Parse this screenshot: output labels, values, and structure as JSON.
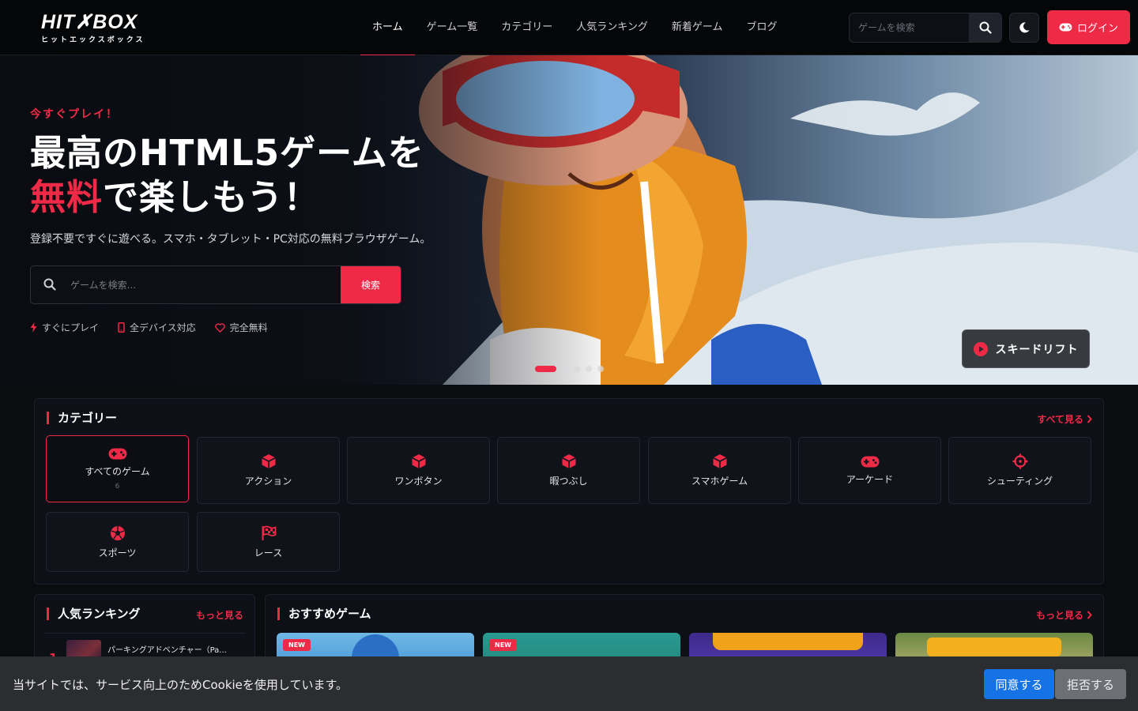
{
  "brand": {
    "logo_text": "HIT✗BOX",
    "logo_sub": "ヒットエックスボックス",
    "accent_color": "#ee2a47"
  },
  "nav": {
    "items": [
      {
        "label": "ホーム",
        "active": true
      },
      {
        "label": "ゲーム一覧"
      },
      {
        "label": "カテゴリー"
      },
      {
        "label": "人気ランキング"
      },
      {
        "label": "新着ゲーム"
      },
      {
        "label": "ブログ"
      }
    ],
    "search_placeholder": "ゲームを検索",
    "login_label": "ログイン"
  },
  "hero": {
    "kicker": "今すぐプレイ！",
    "title_line1": "最高のHTML5ゲームを",
    "title_accent": "無料",
    "title_line2_rest": "で楽しもう！",
    "description": "登録不要ですぐに遊べる。スマホ・タブレット・PC対応の無料ブラウザゲーム。",
    "search_placeholder": "ゲームを検索...",
    "search_button": "検索",
    "features": [
      "すぐにプレイ",
      "全デバイス対応",
      "完全無料"
    ],
    "featured_game": "スキードリフト",
    "slide_count": 5,
    "active_slide": 1
  },
  "categories": {
    "title": "カテゴリー",
    "see_all": "すべて見る",
    "items": [
      {
        "label": "すべてのゲーム",
        "count": "6",
        "icon": "gamepad-icon",
        "active": true
      },
      {
        "label": "アクション",
        "icon": "cube-icon"
      },
      {
        "label": "ワンボタン",
        "icon": "cube-icon"
      },
      {
        "label": "暇つぶし",
        "icon": "cube-icon"
      },
      {
        "label": "スマホゲーム",
        "icon": "cube-icon"
      },
      {
        "label": "アーケード",
        "icon": "gamepad-icon"
      },
      {
        "label": "シューティング",
        "icon": "crosshair-icon"
      },
      {
        "label": "スポーツ",
        "icon": "soccer-ball-icon"
      },
      {
        "label": "レース",
        "icon": "checkered-flag-icon"
      }
    ]
  },
  "ranking": {
    "title": "人気ランキング",
    "more": "もっと見る",
    "items": [
      {
        "rank": "1",
        "name": "パーキングアドベンチャー（Pa..."
      }
    ]
  },
  "recommended": {
    "title": "おすすめゲーム",
    "more": "もっと見る",
    "badge": "NEW"
  },
  "cookie": {
    "text": "当サイトでは、サービス向上のためCookieを使用しています。",
    "agree": "同意する",
    "reject": "拒否する"
  }
}
